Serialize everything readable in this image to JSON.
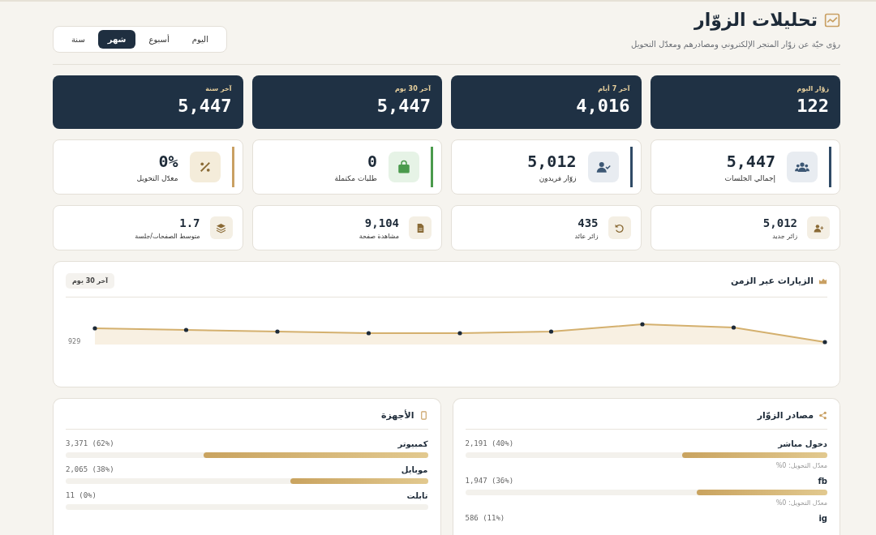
{
  "header": {
    "title": "تحليلات الزوّار",
    "subtitle": "رؤى حيّة عن زوّار المتجر الإلكتروني ومصادرهم ومعدّل التحويل"
  },
  "periods": [
    {
      "label": "اليوم",
      "selected": false
    },
    {
      "label": "أسبوع",
      "selected": false
    },
    {
      "label": "شهر",
      "selected": true
    },
    {
      "label": "سنة",
      "selected": false
    }
  ],
  "summary_cards": [
    {
      "label": "زوّار اليوم",
      "value": "122"
    },
    {
      "label": "آخر 7 أيام",
      "value": "4,016"
    },
    {
      "label": "آخر 30 يوم",
      "value": "5,447"
    },
    {
      "label": "آخر سنة",
      "value": "5,447"
    }
  ],
  "kpi_cards": [
    {
      "label": "إجمالي الجلسات",
      "value": "5,447",
      "color": "#2f4a66"
    },
    {
      "label": "زوّار فريدون",
      "value": "5,012",
      "color": "#2f4a66"
    },
    {
      "label": "طلبات مكتملة",
      "value": "0",
      "color": "#4a9a4c"
    },
    {
      "label": "معدّل التحويل",
      "value": "0%",
      "color": "#c9a063"
    }
  ],
  "mini_cards": [
    {
      "label": "زائر جديد",
      "value": "5,012"
    },
    {
      "label": "زائر عائد",
      "value": "435"
    },
    {
      "label": "مشاهدة صفحة",
      "value": "9,104"
    },
    {
      "label": "متوسط الصفحات/جلسة",
      "value": "1.7"
    }
  ],
  "visits_chart": {
    "title": "الزيارات عبر الزمن",
    "range": "آخر 30 يوم",
    "axis_label": "929"
  },
  "sources": {
    "title": "مصادر الزوّار",
    "items": [
      {
        "name": "دخول مباشر",
        "count": "2,191 (40%)",
        "level": 0.4,
        "conversion": "معدّل التحويل: 0%"
      },
      {
        "name": "fb",
        "count": "1,947 (36%)",
        "level": 0.36,
        "conversion": "معدّل التحويل: 0%"
      },
      {
        "name": "ig",
        "count": "586 (11%)"
      }
    ]
  },
  "devices": {
    "title": "الأجهزة",
    "items": [
      {
        "name": "كمبيوتر",
        "count": "3,371 (62%)",
        "level": 0.62
      },
      {
        "name": "موبايل",
        "count": "2,065 (38%)",
        "level": 0.38
      },
      {
        "name": "تابلت",
        "count": "11 (0%)",
        "level": 0
      }
    ]
  }
}
